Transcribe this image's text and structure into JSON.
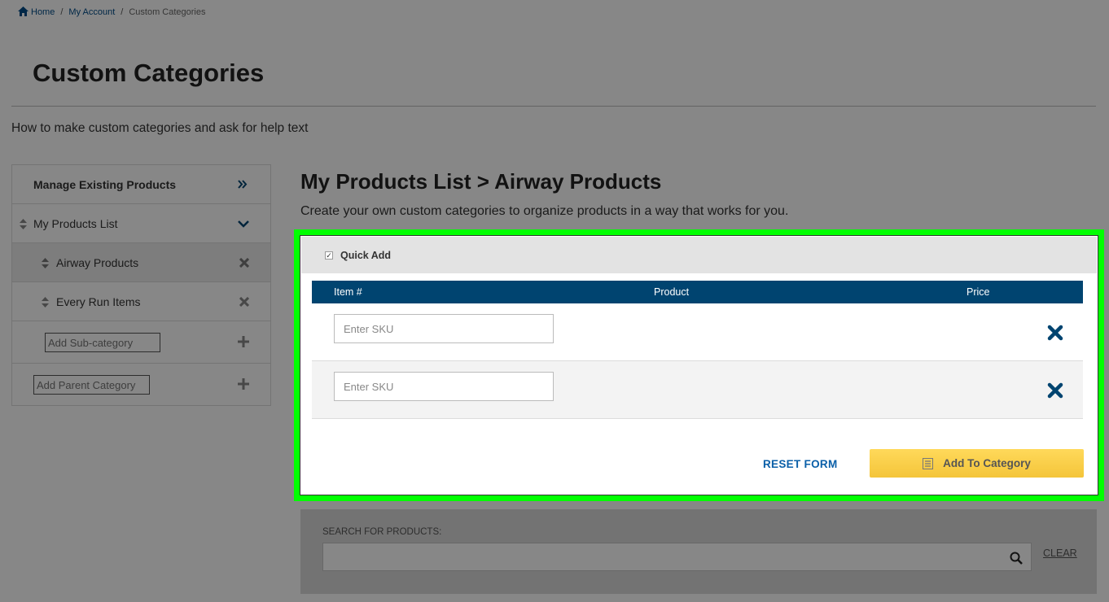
{
  "breadcrumb": {
    "home": "Home",
    "separator": "/",
    "my_account": "My Account",
    "current": "Custom Categories"
  },
  "page_title": "Custom Categories",
  "help_text": "How to make custom categories and ask for help text",
  "sidebar": {
    "manage_label": "Manage Existing Products",
    "list_label": "My Products List",
    "items": [
      {
        "label": "Airway Products"
      },
      {
        "label": "Every Run Items"
      }
    ],
    "sub_category_placeholder": "Add Sub-category",
    "parent_category_placeholder": "Add Parent Category"
  },
  "section": {
    "title": "My Products List > Airway Products",
    "description": "Create your own custom categories to organize products in a way that works for you."
  },
  "quick_add": {
    "title": "Quick Add",
    "checked": true,
    "columns": {
      "item": "Item #",
      "product": "Product",
      "price": "Price"
    },
    "sku_placeholder": "Enter SKU",
    "reset_label": "RESET FORM",
    "add_label": "Add To Category"
  },
  "search": {
    "label": "SEARCH FOR PRODUCTS:",
    "clear_label": "CLEAR"
  },
  "colors": {
    "brand_navy": "#004470",
    "link_blue": "#0a5fa8",
    "highlight": "#00ff00",
    "button_yellow": "#f4c53a"
  }
}
